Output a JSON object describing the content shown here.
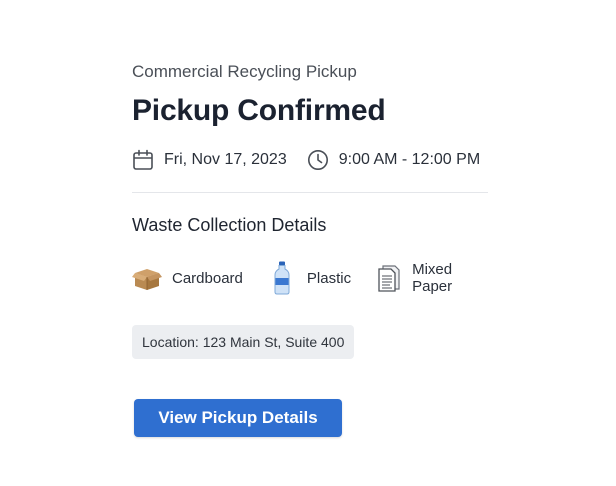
{
  "header": {
    "subtitle": "Commercial Recycling Pickup",
    "title": "Pickup Confirmed"
  },
  "schedule": {
    "date": "Fri, Nov 17, 2023",
    "date_icon": "calendar-icon",
    "time": "9:00 AM - 12:00 PM",
    "time_icon": "clock-icon"
  },
  "details": {
    "section_title": "Waste Collection Details",
    "materials": [
      {
        "label": "Cardboard",
        "icon": "cardboard-box-icon"
      },
      {
        "label": "Plastic",
        "icon": "plastic-bottle-icon"
      },
      {
        "label": "Mixed Paper",
        "icon": "paper-document-icon"
      }
    ],
    "location": "Location: 123 Main St, Suite 400"
  },
  "actions": {
    "view_details_label": "View Pickup Details"
  },
  "colors": {
    "accent": "#2f6fd0",
    "title": "#1b2230",
    "location_bg": "#eceef1"
  }
}
